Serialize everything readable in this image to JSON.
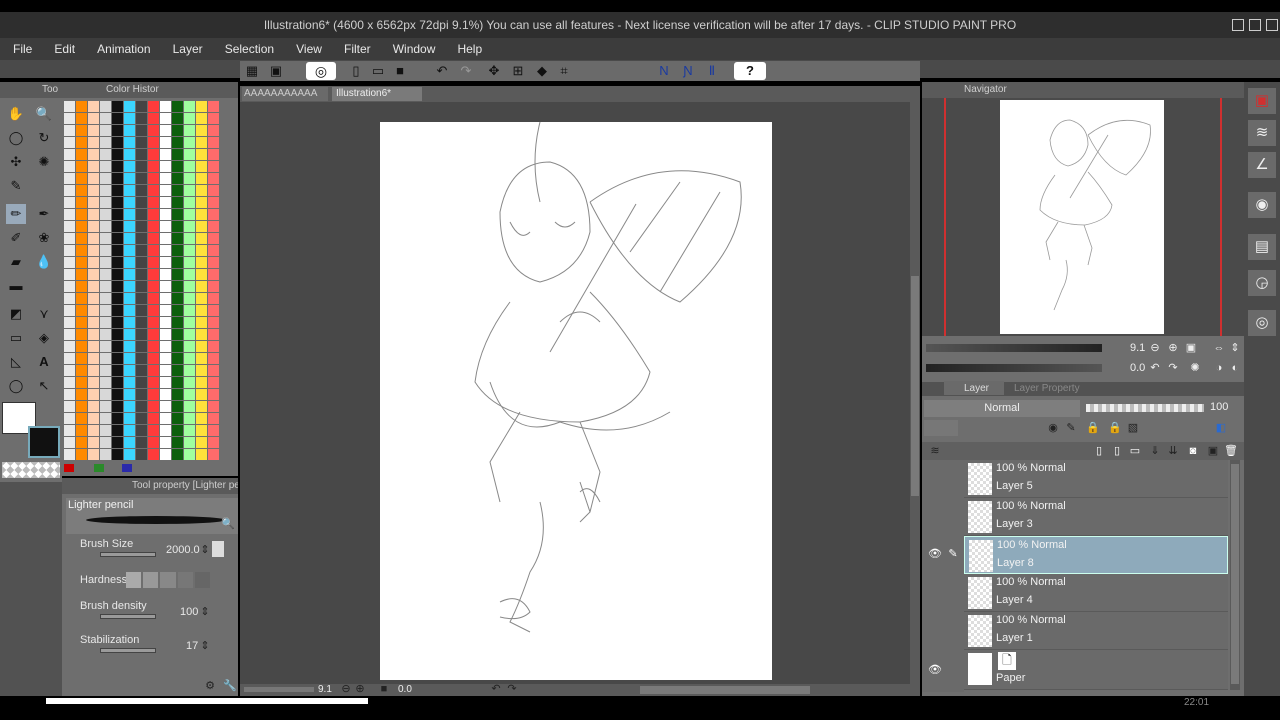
{
  "window": {
    "title": "Illustration6* (4600 x 6562px 72dpi 9.1%)  You can use all features - Next license verification will be after 17 days. - CLIP STUDIO PAINT PRO"
  },
  "menu": [
    "File",
    "Edit",
    "Animation",
    "Layer",
    "Selection",
    "View",
    "Filter",
    "Window",
    "Help"
  ],
  "panels": {
    "tool_tab": "Too",
    "color_history_tab": "Color Histor",
    "tool_property_tab": "Tool property [Lighter pen",
    "navigator_tab": "Navigator",
    "layer_tab": "Layer",
    "layer_property_tab": "Layer Property"
  },
  "doc_tabs": [
    "AAAAAAAAAAA",
    "Illustration6*"
  ],
  "tool_property": {
    "brush_name": "Lighter pencil",
    "brush_size_label": "Brush Size",
    "brush_size": "2000.0",
    "hardness_label": "Hardness",
    "density_label": "Brush density",
    "density": "100",
    "stabilization_label": "Stabilization",
    "stabilization": "17"
  },
  "navigator": {
    "zoom": "9.1",
    "rotation": "0.0"
  },
  "canvas_status": {
    "zoom": "9.1",
    "rotation": "0.0"
  },
  "layer_panel": {
    "blend_mode": "Normal",
    "opacity": "100"
  },
  "layers": [
    {
      "blend": "100 % Normal",
      "name": "Layer 5",
      "visible": false,
      "selected": false
    },
    {
      "blend": "100 % Normal",
      "name": "Layer 3",
      "visible": false,
      "selected": false
    },
    {
      "blend": "100 % Normal",
      "name": "Layer 8",
      "visible": true,
      "selected": true
    },
    {
      "blend": "100 % Normal",
      "name": "Layer 4",
      "visible": false,
      "selected": false
    },
    {
      "blend": "100 % Normal",
      "name": "Layer 1",
      "visible": false,
      "selected": false
    },
    {
      "blend": "",
      "name": "Paper",
      "visible": true,
      "selected": false
    }
  ],
  "taskbar_clock": "22:01",
  "colors": {
    "accent_selected_layer": "#8eaabb",
    "navigator_frame": "#d03030",
    "main_color": "#ffffff",
    "sub_color": "#111111"
  },
  "swatch_palette": [
    "#e9e9e9",
    "#ff3b3b",
    "#ff8fd0",
    "#3b3bff",
    "#111111",
    "#ffe23b",
    "#2fbf2f",
    "#ff8a00",
    "#ffffff",
    "#7a3a00",
    "#b23bff",
    "#3bd6ff",
    "#ff6b6b",
    "#9a9a9a",
    "#ffd0b0",
    "#0d5f0d",
    "#c83b6b",
    "#f5c080",
    "#444444",
    "#ff9fb0",
    "#5a5aff",
    "#d8d8d8",
    "#a0ff9f",
    "#b00000"
  ]
}
